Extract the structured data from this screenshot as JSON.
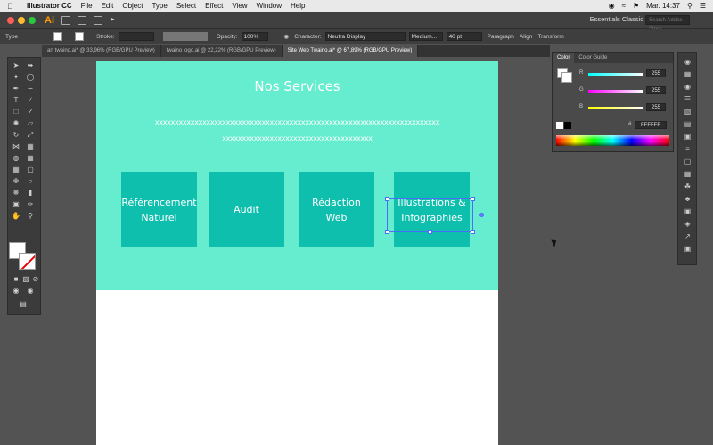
{
  "menubar": {
    "app_name": "Illustrator CC",
    "items": [
      "File",
      "Edit",
      "Object",
      "Type",
      "Select",
      "Effect",
      "View",
      "Window",
      "Help"
    ],
    "clock": "Mar. 14:37"
  },
  "appbar": {
    "logo": "Ai",
    "workspace": "Essentials Classic",
    "search_placeholder": "Search Adobe Stock"
  },
  "control": {
    "type_label": "Type",
    "stroke_label": "Stroke:",
    "opacity_label": "Opacity:",
    "opacity_value": "100%",
    "character_label": "Character:",
    "font_family": "Neutra Display",
    "font_style": "Medium...",
    "font_size": "40 pt",
    "paragraph_label": "Paragraph",
    "align_label": "Align",
    "transform_label": "Transform"
  },
  "tabs": [
    {
      "label": "art twaino.ai* @ 33,96% (RGB/GPU Preview)"
    },
    {
      "label": "twaino logo.ai @ 22,22% (RGB/GPU Preview)"
    },
    {
      "label": "Site Web Twaino.ai* @ 67,89% (RGB/GPU Preview)"
    }
  ],
  "artboard": {
    "title": "Nos Services",
    "x_line_1": "xxxxxxxxxxxxxxxxxxxxxxxxxxxxxxxxxxxxxxxxxxxxxxxxxxxxxxxxxxxxxxxxxxxxxxxx",
    "x_line_2": "xxxxxxxxxxxxxxxxxxxxxxxxxxxxxxxxxxxxxx",
    "cards": [
      {
        "line1": "Référencement",
        "line2": "Naturel"
      },
      {
        "line1": "Audit",
        "line2": ""
      },
      {
        "line1": "Rédaction",
        "line2": "Web"
      },
      {
        "line1": "Illustrations &",
        "line2": "Infographies"
      }
    ]
  },
  "color_panel": {
    "tab_color": "Color",
    "tab_guide": "Color Guide",
    "channels": [
      {
        "name": "R",
        "value": "255"
      },
      {
        "name": "G",
        "value": "255"
      },
      {
        "name": "B",
        "value": "255"
      }
    ],
    "hex_label": "#",
    "hex": "FFFFFF"
  },
  "colors": {
    "hero_bg": "#66ecce",
    "card_bg": "#0fbfae"
  }
}
